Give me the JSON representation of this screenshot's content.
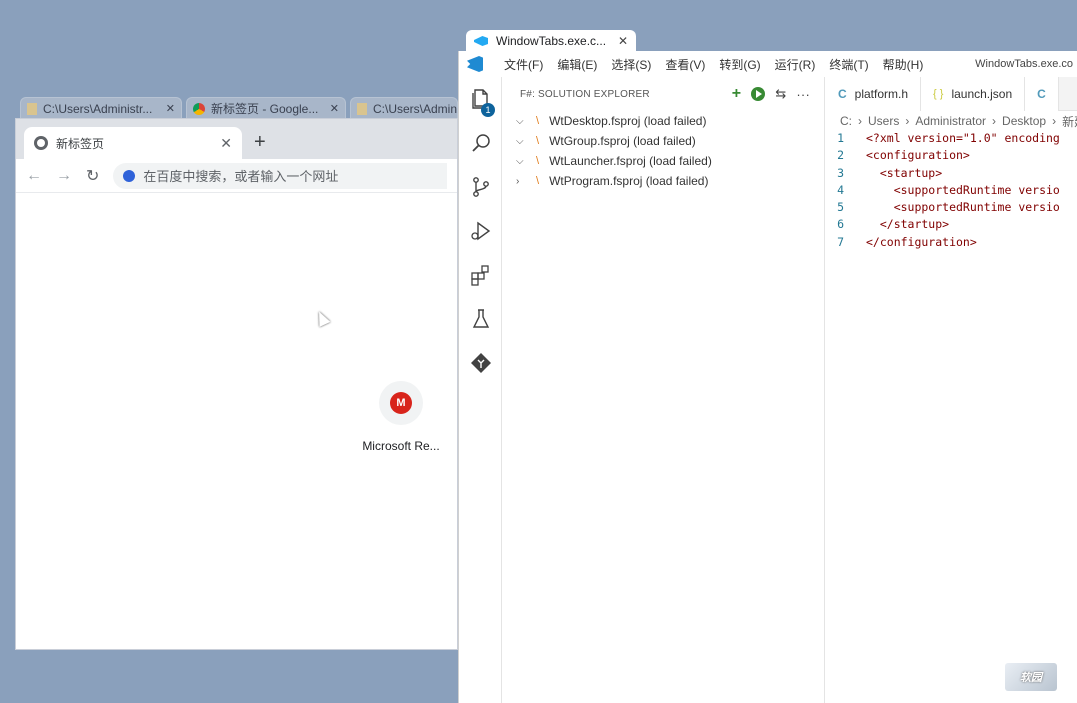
{
  "outer_tabs": [
    {
      "label": "C:\\Users\\Administr...",
      "icon": "folder-icon"
    },
    {
      "label": "新标签页 - Google...",
      "icon": "chrome-icon"
    },
    {
      "label": "C:\\Users\\Admin",
      "icon": "folder-icon"
    }
  ],
  "chrome": {
    "tab_title": "新标签页",
    "omnibox_placeholder": "在百度中搜索，或者输入一个网址",
    "shortcut": {
      "letter": "M",
      "label": "Microsoft Re..."
    }
  },
  "vscode": {
    "window_tab_title": "WindowTabs.exe.c...",
    "title_right": "WindowTabs.exe.co",
    "menu": [
      "文件(F)",
      "编辑(E)",
      "选择(S)",
      "查看(V)",
      "转到(G)",
      "运行(R)",
      "终端(T)",
      "帮助(H)"
    ],
    "explorer_badge": "1",
    "sidebar": {
      "title": "F#: SOLUTION EXPLORER",
      "projects": [
        {
          "name": "WtDesktop.fsproj (load failed)",
          "expanded": true
        },
        {
          "name": "WtGroup.fsproj (load failed)",
          "expanded": true
        },
        {
          "name": "WtLauncher.fsproj (load failed)",
          "expanded": true
        },
        {
          "name": "WtProgram.fsproj (load failed)",
          "expanded": false
        }
      ]
    },
    "editor_tabs": [
      {
        "label": "platform.h",
        "icon": "c-file-icon"
      },
      {
        "label": "launch.json",
        "icon": "json-file-icon"
      }
    ],
    "breadcrumb": [
      "C:",
      "Users",
      "Administrator",
      "Desktop",
      "新建"
    ],
    "code_lines": [
      {
        "n": "1",
        "text": "<?xml version=\"1.0\" encoding"
      },
      {
        "n": "2",
        "text": "<configuration>"
      },
      {
        "n": "3",
        "text": "  <startup>"
      },
      {
        "n": "4",
        "text": "    <supportedRuntime versio"
      },
      {
        "n": "5",
        "text": "    <supportedRuntime versio"
      },
      {
        "n": "6",
        "text": "  </startup>"
      },
      {
        "n": "7",
        "text": "</configuration>"
      }
    ]
  }
}
